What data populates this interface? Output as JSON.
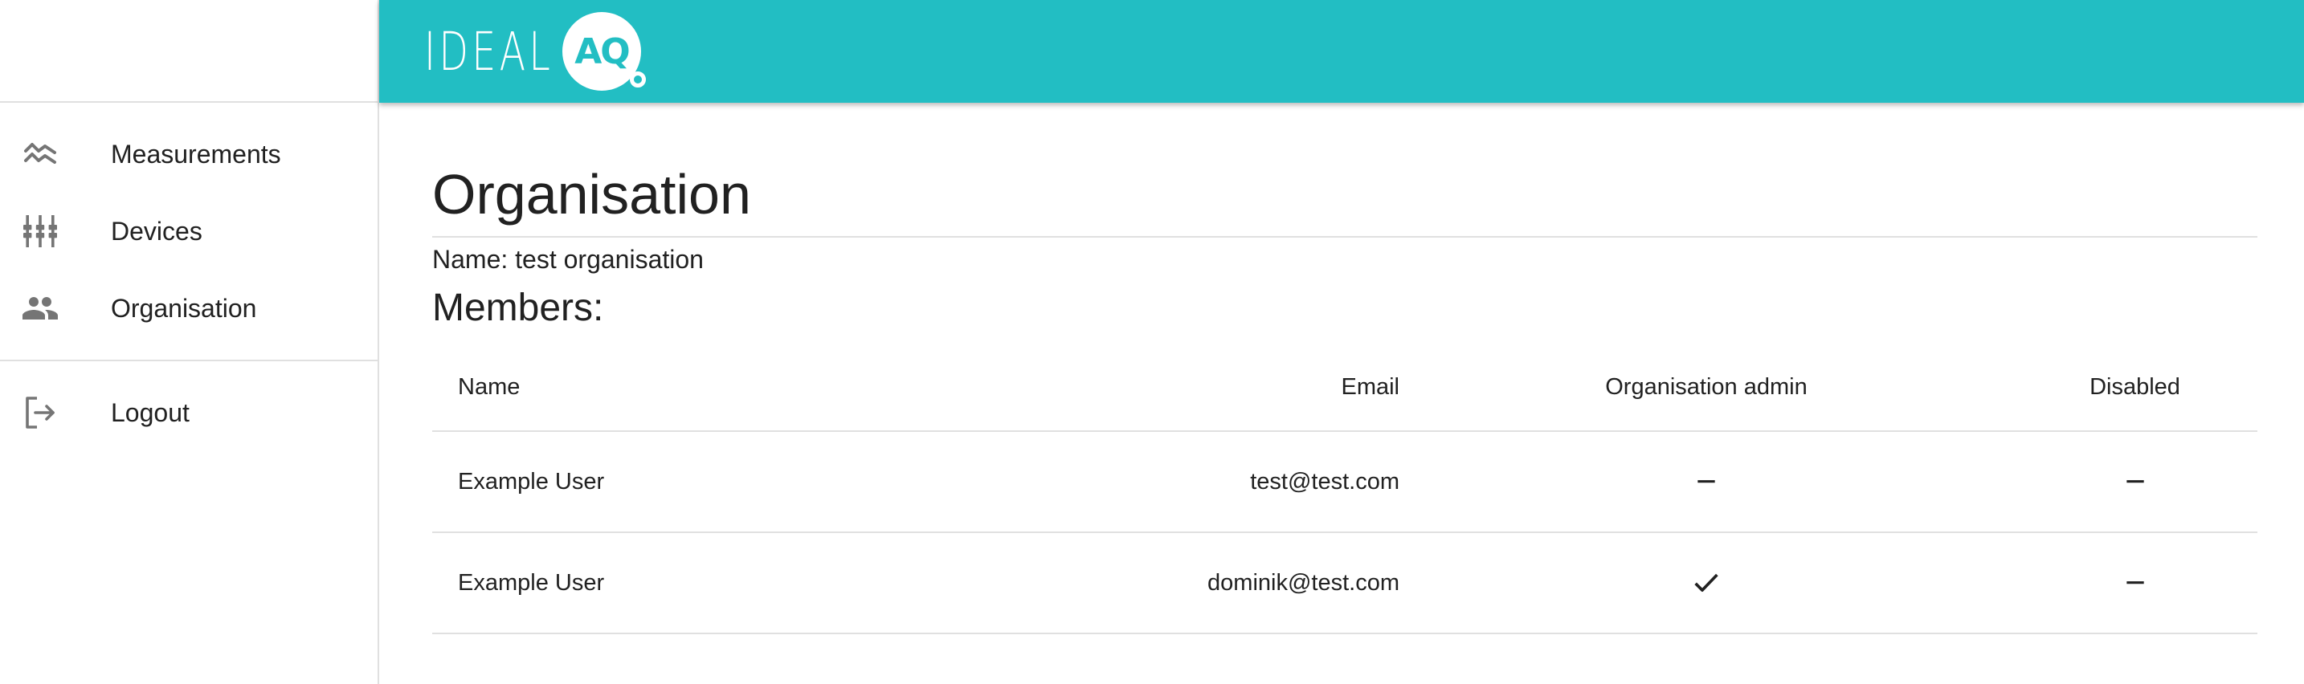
{
  "header": {
    "logo_text": "IDEAL",
    "logo_badge": "AQ",
    "background_color": "#22bec3"
  },
  "sidebar": {
    "items": [
      {
        "label": "Measurements",
        "icon": "measurements-wave-icon"
      },
      {
        "label": "Devices",
        "icon": "devices-sliders-icon"
      },
      {
        "label": "Organisation",
        "icon": "people-icon"
      }
    ],
    "logout": {
      "label": "Logout",
      "icon": "logout-icon"
    }
  },
  "main": {
    "title": "Organisation",
    "name_line": "Name: test organisation",
    "members_heading": "Members:",
    "table": {
      "columns": [
        "Name",
        "Email",
        "Organisation admin",
        "Disabled"
      ],
      "rows": [
        {
          "name": "Example User",
          "email": "test@test.com",
          "admin": "dash-icon",
          "disabled": "dash-icon"
        },
        {
          "name": "Example User",
          "email": "dominik@test.com",
          "admin": "check-icon",
          "disabled": "dash-icon"
        }
      ]
    }
  }
}
